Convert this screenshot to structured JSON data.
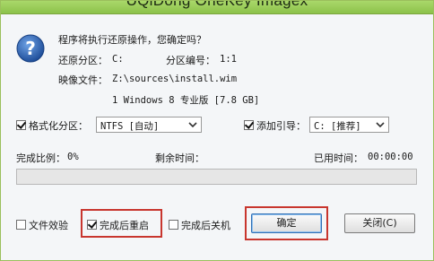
{
  "window": {
    "title": "UQiDong OneKey Imagex"
  },
  "dialog": {
    "question": "程序将执行还原操作，您确定吗？",
    "restore_partition_label": "还原分区：",
    "restore_partition_value": "C:",
    "partition_number_label": "分区编号：",
    "partition_number_value": "1:1",
    "image_file_label": "映像文件：",
    "image_file_value": "Z:\\sources\\install.wim",
    "image_detail": "1 Windows 8 专业版 [7.8 GB]"
  },
  "options": {
    "format_label": "格式化分区：",
    "format_checked": true,
    "format_select_value": "NTFS [自动]",
    "boot_label": "添加引导：",
    "boot_checked": true,
    "boot_select_value": "C: [推荐]"
  },
  "progress": {
    "ratio_label": "完成比例：",
    "ratio_value": "0%",
    "remaining_label": "剩余时间：",
    "elapsed_label": "已用时间：",
    "elapsed_value": "00:00:00",
    "fraction": 0
  },
  "footer": {
    "verify_label": "文件效验",
    "verify_checked": false,
    "restart_label": "完成后重启",
    "restart_checked": true,
    "shutdown_label": "完成后关机",
    "shutdown_checked": false,
    "ok_label": "确定",
    "close_label": "关闭(C)"
  },
  "colors": {
    "titlebar": "#8cc24a",
    "highlight": "#c8362e",
    "progress_fill": "#3c9a3c",
    "icon_blue": "#2a5db0"
  },
  "icons": {
    "question": "question-mark-icon",
    "dropdown": "chevron-down-icon"
  }
}
